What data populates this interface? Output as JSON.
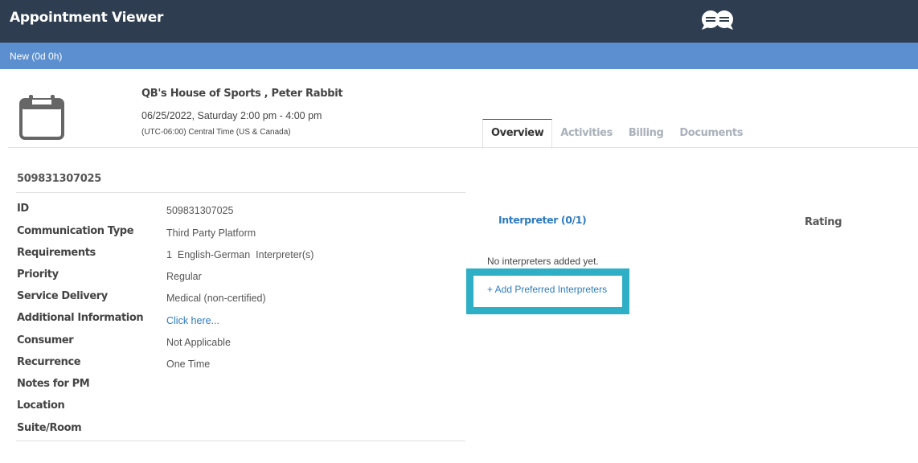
{
  "header": {
    "title": "Appointment Viewer",
    "logo_icon": "chat-bubbles-logo-icon"
  },
  "status": {
    "label": "New (0d 0h)"
  },
  "appointment": {
    "calendar_icon": "calendar-icon",
    "name": "QB's House of Sports , Peter Rabbit",
    "datetime": "06/25/2022, Saturday 2:00 pm - 4:00 pm",
    "timezone": "(UTC-06:00) Central Time (US & Canada)",
    "number": "509831307025"
  },
  "tabs": [
    {
      "label": "Overview",
      "active": true
    },
    {
      "label": "Activities",
      "active": false
    },
    {
      "label": "Billing",
      "active": false
    },
    {
      "label": "Documents",
      "active": false
    }
  ],
  "details": [
    {
      "label": "ID",
      "value": "509831307025"
    },
    {
      "label": "Communication Type",
      "value": "Third Party Platform"
    },
    {
      "label": "Requirements",
      "value": "1  English-German  Interpreter(s)"
    },
    {
      "label": "Priority",
      "value": "Regular"
    },
    {
      "label": "Service Delivery",
      "value": "Medical (non-certified)"
    },
    {
      "label": "Additional Information",
      "value": "Click here..."
    },
    {
      "label": "Consumer",
      "value": "Not Applicable"
    },
    {
      "label": "Recurrence",
      "value": "One Time"
    },
    {
      "label": "Notes for PM",
      "value": ""
    },
    {
      "label": "Location",
      "value": ""
    },
    {
      "label": "Suite/Room",
      "value": ""
    }
  ],
  "interpreters": {
    "heading": "Interpreter (0/1)",
    "rating_heading": "Rating",
    "empty_message": "No interpreters added yet.",
    "add_label": "+ Add Preferred Interpreters"
  },
  "colors": {
    "topbar": "#2e3e50",
    "statusbar": "#5b8fd0",
    "link": "#2d7bc0",
    "highlight": "#2fafc5"
  }
}
